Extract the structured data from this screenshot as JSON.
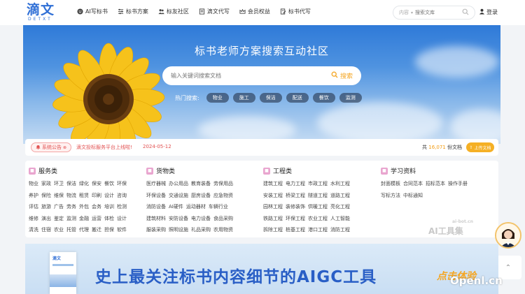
{
  "header": {
    "logo": {
      "main": "滴文",
      "sub": "DETXT"
    },
    "nav": [
      {
        "label": "AI写标书",
        "icon": "robot-icon"
      },
      {
        "label": "标书方案",
        "icon": "sliders-icon"
      },
      {
        "label": "标友社区",
        "icon": "users-icon"
      },
      {
        "label": "滴文代写",
        "icon": "document-icon"
      },
      {
        "label": "会员权益",
        "icon": "crown-icon"
      },
      {
        "label": "标书代写",
        "icon": "file-edit-icon"
      }
    ],
    "search": {
      "category": "内容",
      "placeholder": "搜索文库"
    },
    "login": "登录"
  },
  "hero": {
    "title": "标书老师方案搜索互动社区",
    "search_placeholder": "输入关键词搜索文档",
    "search_button": "搜索",
    "hot_label": "热门搜索:",
    "hot_tags": [
      "物业",
      "施工",
      "保洁",
      "配送",
      "餐饮",
      "监测"
    ]
  },
  "notice": {
    "badge": "系统公告",
    "text": "滴文投标服务平台上线啦!",
    "date": "2024-05-12",
    "count_prefix": "共",
    "count": "16,071",
    "count_suffix": "份文档",
    "upload": "上传文档"
  },
  "categories": [
    {
      "title": "服务类",
      "rows": [
        [
          "物业",
          "家政",
          "环卫",
          "保洁",
          "绿化",
          "保安",
          "餐饮",
          "环保"
        ],
        [
          "养护",
          "保险",
          "维保",
          "物流",
          "租赁",
          "印刷",
          "设计",
          "咨询"
        ],
        [
          "评估",
          "旅游",
          "广告",
          "劳务",
          "外包",
          "会务",
          "培训",
          "检测"
        ],
        [
          "维修",
          "演出",
          "鉴定",
          "监测",
          "金融",
          "运营",
          "体检",
          "设计"
        ],
        [
          "清洗",
          "住宿",
          "农业",
          "托管",
          "代理",
          "搬迁",
          "担保",
          "软件"
        ]
      ]
    },
    {
      "title": "货物类",
      "rows": [
        [
          "医疗器械",
          "办公用品",
          "教育装备",
          "劳保用品"
        ],
        [
          "环保设备",
          "交通设施",
          "厨房设备",
          "应急物资"
        ],
        [
          "消防设备",
          "AI硬件",
          "运动器材",
          "车辆行业"
        ],
        [
          "建筑材料",
          "安防设备",
          "电力设备",
          "食品采购"
        ],
        [
          "服装采购",
          "照明设施",
          "礼品采购",
          "农用物资"
        ]
      ]
    },
    {
      "title": "工程类",
      "rows": [
        [
          "建筑工程",
          "电力工程",
          "市政工程",
          "水利工程"
        ],
        [
          "安装工程",
          "桥梁工程",
          "隧道工程",
          "道路工程"
        ],
        [
          "园林工程",
          "装修装饰",
          "供暖工程",
          "亮化工程"
        ],
        [
          "铁路工程",
          "环保工程",
          "农业工程",
          "人工智能"
        ],
        [
          "拆除工程",
          "桩基工程",
          "港口工程",
          "消防工程"
        ]
      ]
    },
    {
      "title": "学习资料",
      "rows": [
        [
          "封面模板",
          "合同范本",
          "招标范本",
          "操作手册"
        ],
        [
          "写标方法",
          "中标通知"
        ]
      ]
    }
  ],
  "watermarks": {
    "ai_bot_small": "ai-bot.cn",
    "ai_bot": "AI工具集",
    "openl": "Openl.cn"
  },
  "banner": {
    "book_logo": "滴文",
    "headline": "史上最关注标书内容细节的AIGC工具",
    "cta": "点击体验"
  },
  "colors": {
    "brand": "#2f6fd6",
    "accent": "#f5b025",
    "notice_red": "#e25151"
  }
}
